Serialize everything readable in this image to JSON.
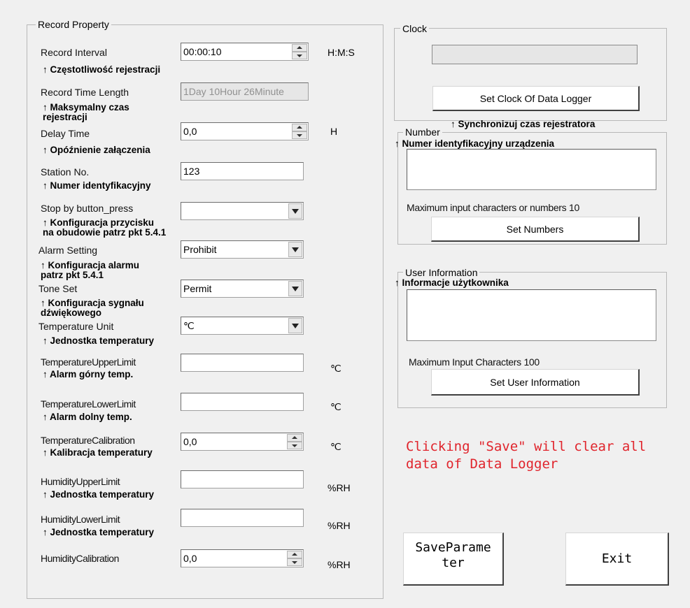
{
  "record": {
    "title": "Record Property",
    "interval": {
      "label": "Record Interval",
      "value": "00:00:10",
      "unit": "H:M:S",
      "note": "↑ Częstotliwość rejestracji"
    },
    "time_length": {
      "label": "Record Time Length",
      "value": "1Day 10Hour 26Minute",
      "note": "↑ Maksymalny czas\nrejestracji"
    },
    "delay": {
      "label": "Delay Time",
      "value": "0,0",
      "unit": "H",
      "note": "↑ Opóźnienie załączenia"
    },
    "station": {
      "label": "Station No.",
      "value": "123",
      "note": "↑ Numer identyfikacyjny"
    },
    "stop": {
      "label": "Stop by button_press",
      "value": "",
      "note": "↑ Konfiguracja przycisku\nna obudowie patrz pkt 5.4.1"
    },
    "alarm": {
      "label": "Alarm Setting",
      "value": "Prohibit",
      "note": "↑ Konfiguracja alarmu\npatrz pkt 5.4.1"
    },
    "tone": {
      "label": "Tone Set",
      "value": "Permit",
      "note": "↑ Konfiguracja sygnału\ndźwiękowego"
    },
    "temp_unit": {
      "label": "Temperature Unit",
      "value": "℃",
      "note": "↑ Jednostka temperatury"
    },
    "temp_upper": {
      "label": "TemperatureUpperLimit",
      "value": "",
      "unit": "℃",
      "note": "↑ Alarm górny temp."
    },
    "temp_lower": {
      "label": "TemperatureLowerLimit",
      "value": "",
      "unit": "℃",
      "note": "↑ Alarm dolny temp."
    },
    "temp_cal": {
      "label": "TemperatureCalibration",
      "value": "0,0",
      "unit": "℃",
      "note": "↑ Kalibracja temperatury"
    },
    "hum_upper": {
      "label": "HumidityUpperLimit",
      "value": "",
      "unit": "%RH",
      "note": "↑ Jednostka temperatury"
    },
    "hum_lower": {
      "label": "HumidityLowerLimit",
      "value": "",
      "unit": "%RH",
      "note": "↑ Jednostka temperatury"
    },
    "hum_cal": {
      "label": "HumidityCalibration",
      "value": "0,0",
      "unit": "%RH"
    }
  },
  "clock": {
    "title": "Clock",
    "display": "",
    "button": "Set Clock Of Data Logger",
    "note": "↑ Synchronizuj czas rejestratora"
  },
  "number": {
    "title": "Number",
    "note": "↑ Numer identyfikacyjny urządzenia",
    "value": "",
    "max_text": "Maximum input characters or numbers 10",
    "button": "Set Numbers"
  },
  "user": {
    "title": "User Information",
    "note": "↑ Informacje użytkownika",
    "value": "",
    "max_text": "Maximum Input Characters 100",
    "button": "Set User Information"
  },
  "warning": "Clicking \"Save\" will clear all\ndata of Data Logger",
  "save_button": "SaveParame\nter",
  "exit_button": "Exit",
  "colors": {
    "warning": "#e0242c",
    "background": "#f0f0f0"
  }
}
